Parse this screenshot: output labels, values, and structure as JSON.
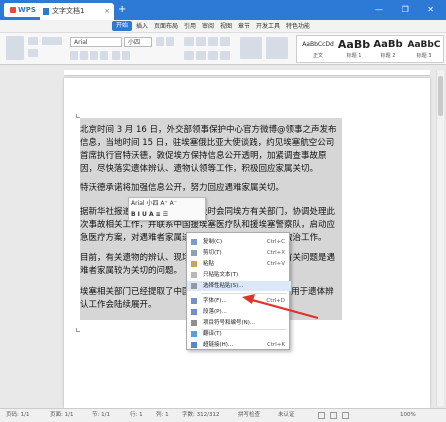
{
  "titlebar": {
    "app": "WPS",
    "doc_tab": "文字文档1",
    "add_tab": "+",
    "controls": "— ❐ ✕"
  },
  "menu": [
    "开始",
    "插入",
    "页面布局",
    "引用",
    "审阅",
    "视图",
    "章节",
    "开发工具",
    "特色功能"
  ],
  "menu_active_index": 0,
  "ribbon": {
    "font_name": "Arial",
    "font_size": "小四",
    "styles": [
      {
        "sample": "AaBbCcDd",
        "name": "正文"
      },
      {
        "sample": "AaBb",
        "name": "标题 1"
      },
      {
        "sample": "AaBb",
        "name": "标题 2"
      },
      {
        "sample": "AaBbC",
        "name": "标题 3"
      }
    ]
  },
  "document": {
    "paragraphs": [
      "北京时间 3 月 16 日，外交部领事保护中心官方微博@领事之声发布信息，当地时间 15 日，驻埃塞俄比亚大使谈践，约见埃塞航空公司首席执行官特沃德，敦促埃方保持信息公开透明，加紧调查事故原因，尽快落实遗体辨认、遗物认领等工作，积极回应家属关切。",
      "特沃德承诺将加强信息公开，努力回应遇难家属关切。",
      "据新华社报道，中国驻埃塞使馆及时会同埃方有关部门，协调处理此次事故相关工作，并联系中国援埃塞医疗队和援埃塞警察队，启动应急医疗方案，对遇难者家属进行安抚并安排可能出现的救治工作。",
      "目前，有关遗物的辨认、现场清理等工作仍在进行中，有关问题是遇难者家属较为关切的问题。",
      "埃塞相关部门已经提取了中国遇难者家属的 DNA 样本，用于遗体辨认工作会陆续展开。"
    ]
  },
  "mini_toolbar": {
    "row1": "Arial  小四  A⁺ A⁻",
    "row2": "B  I  U  A  ≡  ☰"
  },
  "context_menu": [
    {
      "label": "复制(C)",
      "shortcut": "Ctrl+C"
    },
    {
      "label": "剪切(T)",
      "shortcut": "Ctrl+X"
    },
    {
      "label": "粘贴",
      "shortcut": "Ctrl+V"
    },
    {
      "label": "只粘贴文本(T)",
      "shortcut": ""
    },
    {
      "label": "选择性粘贴(S)...",
      "shortcut": ""
    },
    {
      "label": "字体(F)...",
      "shortcut": "Ctrl+D"
    },
    {
      "label": "段落(P)...",
      "shortcut": ""
    },
    {
      "label": "项目符号和编号(N)...",
      "shortcut": ""
    },
    {
      "label": "翻译(T)",
      "shortcut": ""
    },
    {
      "label": "超链接(H)...",
      "shortcut": "Ctrl+K"
    }
  ],
  "context_menu_highlight_index": 4,
  "arrow_color": "#e0332b",
  "accent_color": "#2d7ad6",
  "statusbar": {
    "page": "页码: 1/1",
    "pages": "页面: 1/1",
    "section": "节: 1/1",
    "row": "行: 1",
    "col": "列: 1",
    "words": "字数: 312/312",
    "spell": "拼写检查",
    "auth": "未认证",
    "zoom": "100%"
  }
}
